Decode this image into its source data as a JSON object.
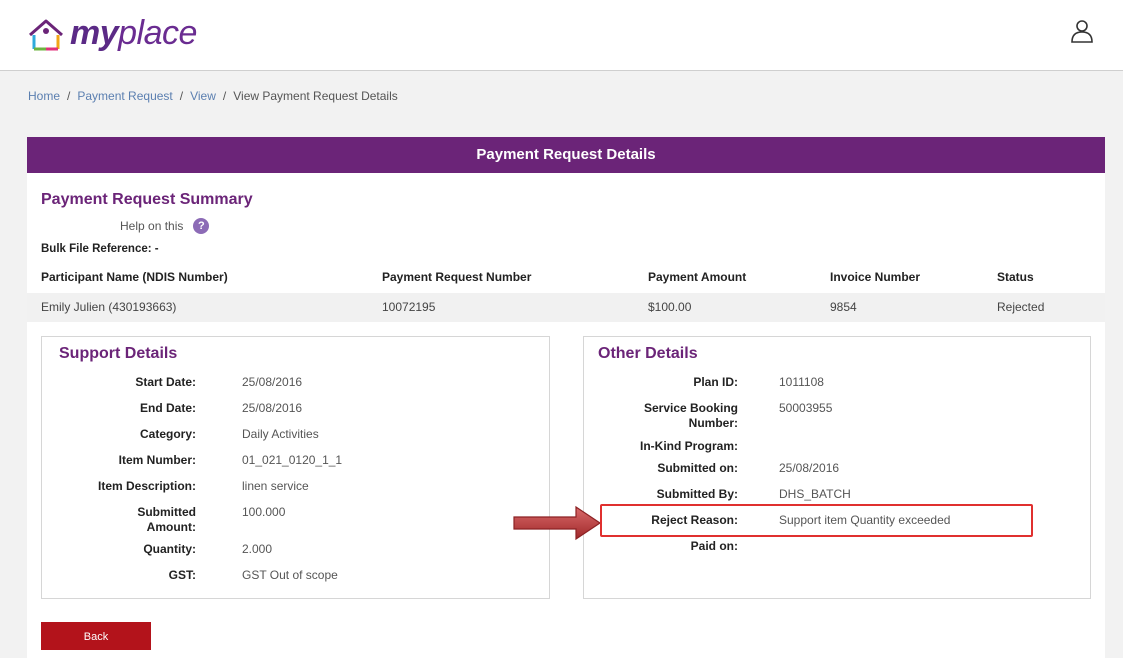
{
  "brand": {
    "logo_part1": "my",
    "logo_part2": "place"
  },
  "breadcrumb": [
    {
      "label": "Home",
      "link": true
    },
    {
      "label": "Payment Request",
      "link": true
    },
    {
      "label": "View",
      "link": true
    },
    {
      "label": "View Payment Request Details",
      "link": false
    }
  ],
  "page_title": "Payment Request Details",
  "summary": {
    "title": "Payment Request Summary",
    "help_label": "Help on this",
    "help_icon": "?",
    "bulk_ref": "Bulk File Reference: -",
    "columns": [
      "Participant Name (NDIS Number)",
      "Payment Request Number",
      "Payment Amount",
      "Invoice Number",
      "Status"
    ],
    "rows": [
      [
        "Emily Julien (430193663)",
        "10072195",
        "$100.00",
        "9854",
        "Rejected"
      ]
    ]
  },
  "support_details": {
    "title": "Support Details",
    "fields": [
      {
        "label": "Start Date:",
        "value": "25/08/2016"
      },
      {
        "label": "End Date:",
        "value": "25/08/2016"
      },
      {
        "label": "Category:",
        "value": "Daily Activities"
      },
      {
        "label": "Item Number:",
        "value": "01_021_0120_1_1"
      },
      {
        "label": "Item Description:",
        "value": "linen service"
      },
      {
        "label": "Submitted Amount:",
        "value": "100.000"
      },
      {
        "label": "Quantity:",
        "value": "2.000"
      },
      {
        "label": "GST:",
        "value": "GST Out of scope"
      }
    ]
  },
  "other_details": {
    "title": "Other Details",
    "fields": [
      {
        "label": "Plan ID:",
        "value": "1011108"
      },
      {
        "label": "Service Booking Number:",
        "value": "50003955"
      },
      {
        "label": "In-Kind Program:",
        "value": ""
      },
      {
        "label": "Submitted on:",
        "value": "25/08/2016"
      },
      {
        "label": "Submitted By:",
        "value": "DHS_BATCH"
      },
      {
        "label": "Reject Reason:",
        "value": "Support item Quantity exceeded"
      },
      {
        "label": "Paid on:",
        "value": ""
      }
    ]
  },
  "actions": {
    "back_label": "Back"
  },
  "colors": {
    "brand_purple": "#6b2478",
    "back_red": "#b3131b",
    "highlight_red": "#e0302f"
  }
}
